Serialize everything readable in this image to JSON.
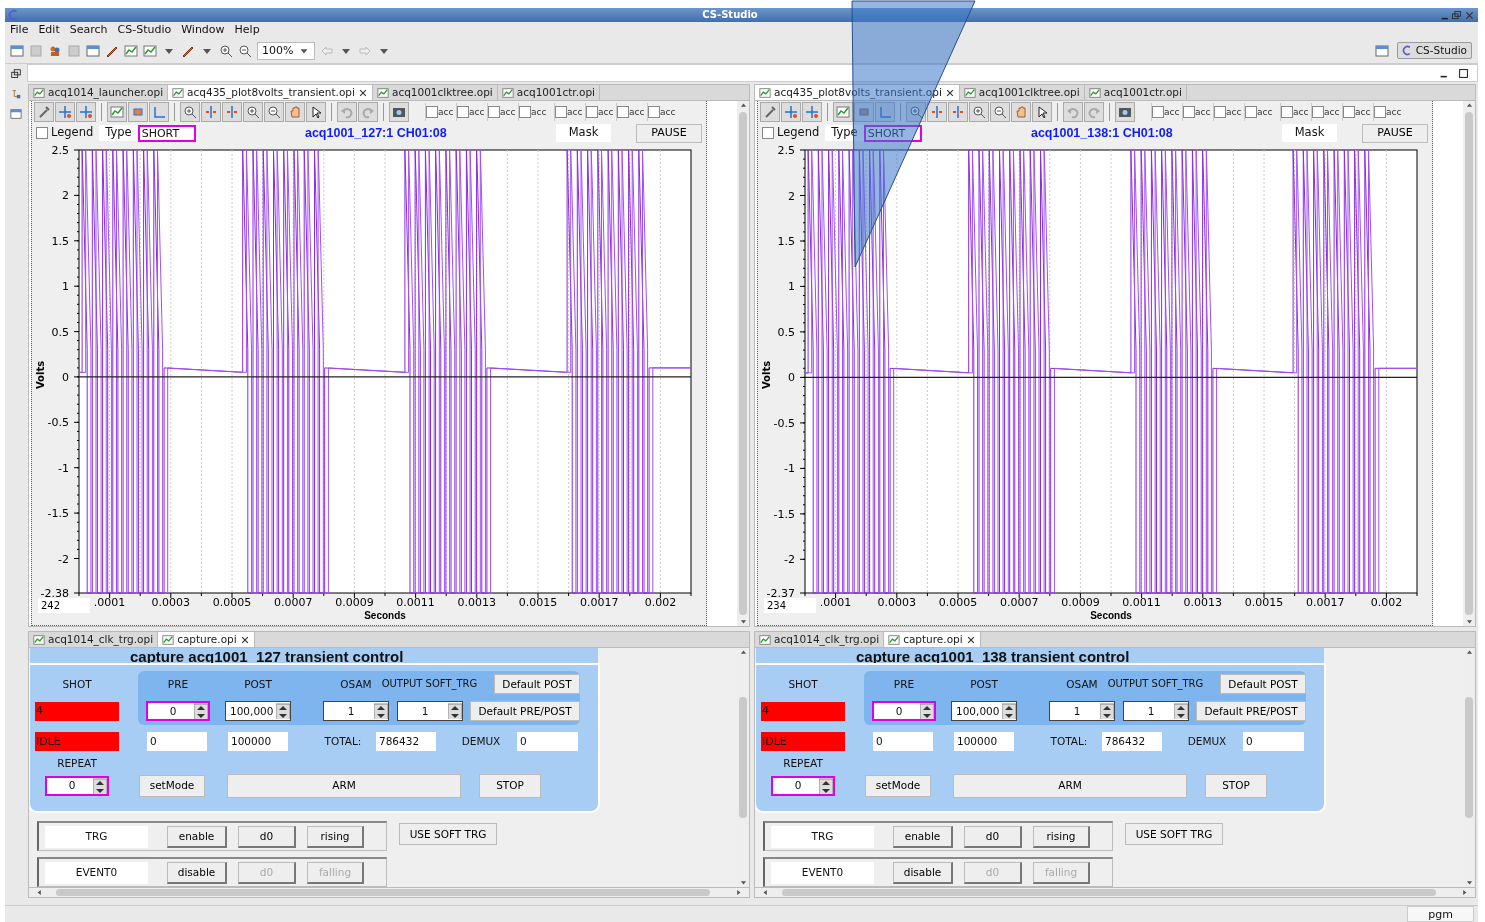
{
  "window": {
    "title": "CS-Studio"
  },
  "menu": [
    "File",
    "Edit",
    "Search",
    "CS-Studio",
    "Window",
    "Help"
  ],
  "toolbar": {
    "zoom": "100%"
  },
  "perspective": {
    "label": "CS-Studio"
  },
  "overlay": {
    "kind": "wedge"
  },
  "panes": [
    {
      "editor_tabs": [
        {
          "label": "acq1014_launcher.opi",
          "selected": false
        },
        {
          "label": "acq435_plot8volts_transient.opi",
          "selected": true
        },
        {
          "label": "acq1001clktree.opi",
          "selected": false
        },
        {
          "label": "acq1001ctr.opi",
          "selected": false
        }
      ],
      "plot": {
        "trace_toggles": [
          {
            "label": "acc",
            "checked": false
          },
          {
            "label": "acc",
            "checked": false
          },
          {
            "label": "acc",
            "checked": false
          },
          {
            "label": "acc",
            "checked": false
          },
          {
            "label": "acc",
            "checked": false
          },
          {
            "label": "acc",
            "checked": false
          },
          {
            "label": "acc",
            "checked": false
          },
          {
            "label": "acc",
            "checked": false
          }
        ],
        "legend": {
          "label": "Legend",
          "checked": false
        },
        "type_label": "Type",
        "type_value": "SHORT",
        "title": "acq1001_127:1 CH01:08",
        "mask": "Mask",
        "pause": "PAUSE",
        "y_label": "Volts",
        "x_label": "Seconds",
        "counter": "242",
        "y_ticks": [
          "2.5",
          "2",
          "1.5",
          "1",
          "0.5",
          "0",
          "-0.5",
          "-1",
          "-1.5",
          "-2",
          "-2.38"
        ],
        "x_ticks": [
          ".0001",
          "0.0003",
          "0.0005",
          "0.0007",
          "0.0009",
          "0.0011",
          "0.0013",
          "0.0015",
          "0.0017",
          "0.002"
        ]
      },
      "bottom_tabs": [
        {
          "label": "acq1014_clk_trg.opi",
          "selected": false
        },
        {
          "label": "capture.opi",
          "selected": true
        }
      ],
      "control": {
        "title": "capture acq1001_127 transient  control",
        "shot_label": "SHOT",
        "shot": "4",
        "state": "IDLE",
        "pre_label": "PRE",
        "post_label": "POST",
        "osam_label": "OSAM",
        "output_label": "OUTPUT SOFT_TRG",
        "default_post": "Default POST",
        "default_prepost": "Default PRE/POST",
        "pre": {
          "value": "0",
          "outlined": true
        },
        "post": {
          "value": "100,000",
          "outlined": false
        },
        "osam": {
          "value": "1",
          "outlined": false
        },
        "soft_trg": {
          "value": "1",
          "outlined": false
        },
        "pre_readback": "0",
        "post_readback": "100000",
        "total_label": "TOTAL:",
        "total": "786432",
        "demux_label": "DEMUX",
        "demux": "0",
        "repeat_label": "REPEAT",
        "repeat": {
          "value": "0",
          "outlined": true
        },
        "set_mode": "setMode",
        "arm": "ARM",
        "stop": "STOP",
        "use_soft_trg": "USE SOFT TRG",
        "trigger_rows": [
          {
            "name": "TRG",
            "buttons": [
              {
                "label": "enable",
                "disabled": false
              },
              {
                "label": "d0",
                "disabled": false
              },
              {
                "label": "rising",
                "disabled": false
              }
            ]
          },
          {
            "name": "EVENT0",
            "buttons": [
              {
                "label": "disable",
                "disabled": false
              },
              {
                "label": "d0",
                "disabled": true
              },
              {
                "label": "falling",
                "disabled": true
              }
            ]
          }
        ]
      }
    },
    {
      "editor_tabs": [
        {
          "label": "acq435_plot8volts_transient.opi",
          "selected": true
        },
        {
          "label": "acq1001clktree.opi",
          "selected": false
        },
        {
          "label": "acq1001ctr.opi",
          "selected": false
        }
      ],
      "plot": {
        "trace_toggles": [
          {
            "label": "acc",
            "checked": false
          },
          {
            "label": "acc",
            "checked": false
          },
          {
            "label": "acc",
            "checked": false
          },
          {
            "label": "acc",
            "checked": false
          },
          {
            "label": "acc",
            "checked": false
          },
          {
            "label": "acc",
            "checked": false
          },
          {
            "label": "acc",
            "checked": false
          },
          {
            "label": "acc",
            "checked": false
          }
        ],
        "legend": {
          "label": "Legend",
          "checked": false
        },
        "type_label": "Type",
        "type_value": "SHORT",
        "title": "acq1001_138:1 CH01:08",
        "mask": "Mask",
        "pause": "PAUSE",
        "y_label": "Volts",
        "x_label": "Seconds",
        "counter": "234",
        "y_ticks": [
          "2.5",
          "2",
          "1.5",
          "1",
          "0.5",
          "0",
          "-0.5",
          "-1",
          "-1.5",
          "-2",
          "-2.37"
        ],
        "x_ticks": [
          ".0001",
          "0.0003",
          "0.0005",
          "0.0007",
          "0.0009",
          "0.0011",
          "0.0013",
          "0.0015",
          "0.0017",
          "0.002"
        ]
      },
      "bottom_tabs": [
        {
          "label": "acq1014_clk_trg.opi",
          "selected": false
        },
        {
          "label": "capture.opi",
          "selected": true
        }
      ],
      "control": {
        "title": "capture acq1001_138 transient  control",
        "shot_label": "SHOT",
        "shot": "4",
        "state": "IDLE",
        "pre_label": "PRE",
        "post_label": "POST",
        "osam_label": "OSAM",
        "output_label": "OUTPUT SOFT_TRG",
        "default_post": "Default POST",
        "default_prepost": "Default PRE/POST",
        "pre": {
          "value": "0",
          "outlined": true
        },
        "post": {
          "value": "100,000",
          "outlined": false
        },
        "osam": {
          "value": "1",
          "outlined": false
        },
        "soft_trg": {
          "value": "1",
          "outlined": false
        },
        "pre_readback": "0",
        "post_readback": "100000",
        "total_label": "TOTAL:",
        "total": "786432",
        "demux_label": "DEMUX",
        "demux": "0",
        "repeat_label": "REPEAT",
        "repeat": {
          "value": "0",
          "outlined": true
        },
        "set_mode": "setMode",
        "arm": "ARM",
        "stop": "STOP",
        "use_soft_trg": "USE SOFT TRG",
        "trigger_rows": [
          {
            "name": "TRG",
            "buttons": [
              {
                "label": "enable",
                "disabled": false
              },
              {
                "label": "d0",
                "disabled": false
              },
              {
                "label": "rising",
                "disabled": false
              }
            ]
          },
          {
            "name": "EVENT0",
            "buttons": [
              {
                "label": "disable",
                "disabled": false
              },
              {
                "label": "d0",
                "disabled": true
              },
              {
                "label": "falling",
                "disabled": true
              }
            ]
          }
        ]
      }
    }
  ],
  "status_bar": {
    "user": "pgm"
  }
}
